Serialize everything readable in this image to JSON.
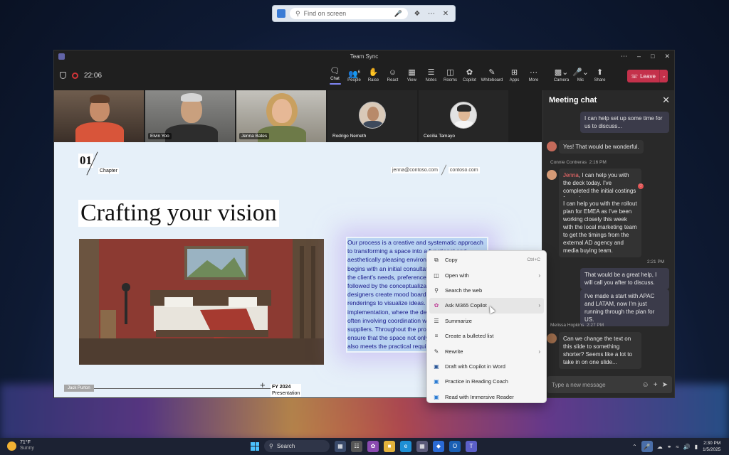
{
  "find_bar": {
    "placeholder": "Find on screen",
    "icons": [
      "app-icon",
      "search-icon",
      "mic-icon",
      "extension-icon",
      "more-icon",
      "close-icon"
    ]
  },
  "window": {
    "title": "Team Sync",
    "timer": "22:06"
  },
  "toolbar": {
    "items": [
      {
        "label": "Chat",
        "icon": "chat-icon",
        "active": true
      },
      {
        "label": "People",
        "icon": "people-icon",
        "badge": "6"
      },
      {
        "label": "Raise",
        "icon": "hand-icon"
      },
      {
        "label": "React",
        "icon": "smile-icon"
      },
      {
        "label": "View",
        "icon": "grid-icon"
      },
      {
        "label": "Notes",
        "icon": "notes-icon"
      },
      {
        "label": "Rooms",
        "icon": "rooms-icon"
      },
      {
        "label": "Copilot",
        "icon": "copilot-icon"
      },
      {
        "label": "Whiteboard",
        "icon": "whiteboard-icon"
      },
      {
        "label": "Apps",
        "icon": "apps-icon"
      },
      {
        "label": "More",
        "icon": "more-icon"
      },
      {
        "label": "Camera",
        "icon": "camera-icon"
      },
      {
        "label": "Mic",
        "icon": "mic-icon"
      },
      {
        "label": "Share",
        "icon": "share-icon"
      }
    ],
    "leave_label": "Leave"
  },
  "participants": [
    {
      "name": ""
    },
    {
      "name": "Elvin Yoo"
    },
    {
      "name": "Jenna Bates"
    },
    {
      "name": "Rodrigo Nemeth"
    },
    {
      "name": "Cecilia Tamayo"
    }
  ],
  "slide": {
    "number": "01",
    "chapter": "Chapter",
    "email1": "jenna@contoso.com",
    "email2": "contoso.com",
    "title": "Crafting your vision",
    "body_lines": [
      "Our process is a creative and systematic approach",
      "to transforming a space into a functional and",
      "aesthetically pleasing environm",
      "begins with an initial consultat",
      "the client's needs, preferences,",
      "followed by the conceptualizati",
      "designers create mood boards",
      "renderings to visualize ideas. T",
      "implementation, where the des",
      "often involving coordination w",
      "suppliers. Throughout the proc",
      "ensure that the space not only",
      "also meets the practical requir"
    ],
    "footer_name": "Jack Purton",
    "footer_fy": "FY 2024",
    "footer_sub": "Presentation"
  },
  "chat": {
    "title": "Meeting chat",
    "messages": [
      {
        "text": "I can help set up some time for us to discuss..."
      },
      {
        "text": "Yes! That would be wonderful."
      },
      {
        "author": "Connie Contreras",
        "time": "2:16 PM"
      },
      {
        "mention": "Jenna",
        "text": ", I can help you with the deck today. I've completed the initial costings for spring."
      },
      {
        "text": "I can help you with the rollout plan for EMEA as I've been working closely this week with the local marketing team to get the timings from the external AD agency and media buying team."
      },
      {
        "time": "2:21 PM"
      },
      {
        "text": "That would be a great help, I will call you after to discuss."
      },
      {
        "text": "I've made a start with APAC and LATAM, now I'm just running through the plan for US."
      },
      {
        "author": "Melissa Hopkins",
        "time": "2:27 PM"
      },
      {
        "text": "Can we change the text on this slide to something shorter? Seems like a lot to take in on one slide..."
      }
    ],
    "compose_placeholder": "Type a new message"
  },
  "context_menu": {
    "items": [
      {
        "label": "Copy",
        "shortcut": "Ctrl+C",
        "icon": "copy-icon"
      },
      {
        "label": "Open with",
        "submenu": true,
        "icon": "open-with-icon"
      },
      {
        "label": "Search the web",
        "icon": "search-icon"
      },
      {
        "label": "Ask M365 Copilot",
        "submenu": true,
        "icon": "copilot-icon",
        "hover": true
      },
      {
        "label": "Summarize",
        "icon": "summarize-icon"
      },
      {
        "label": "Create a bulleted list",
        "icon": "list-icon"
      },
      {
        "label": "Rewrite",
        "submenu": true,
        "icon": "rewrite-icon"
      },
      {
        "label": "Draft with Copilot in Word",
        "icon": "word-icon"
      },
      {
        "label": "Practice in Reading Coach",
        "icon": "reading-coach-icon"
      },
      {
        "label": "Read with Immersive Reader",
        "icon": "immersive-reader-icon"
      }
    ]
  },
  "taskbar": {
    "temp": "71°F",
    "condition": "Sunny",
    "search_label": "Search",
    "time": "2:30 PM",
    "date": "1/5/2025"
  }
}
